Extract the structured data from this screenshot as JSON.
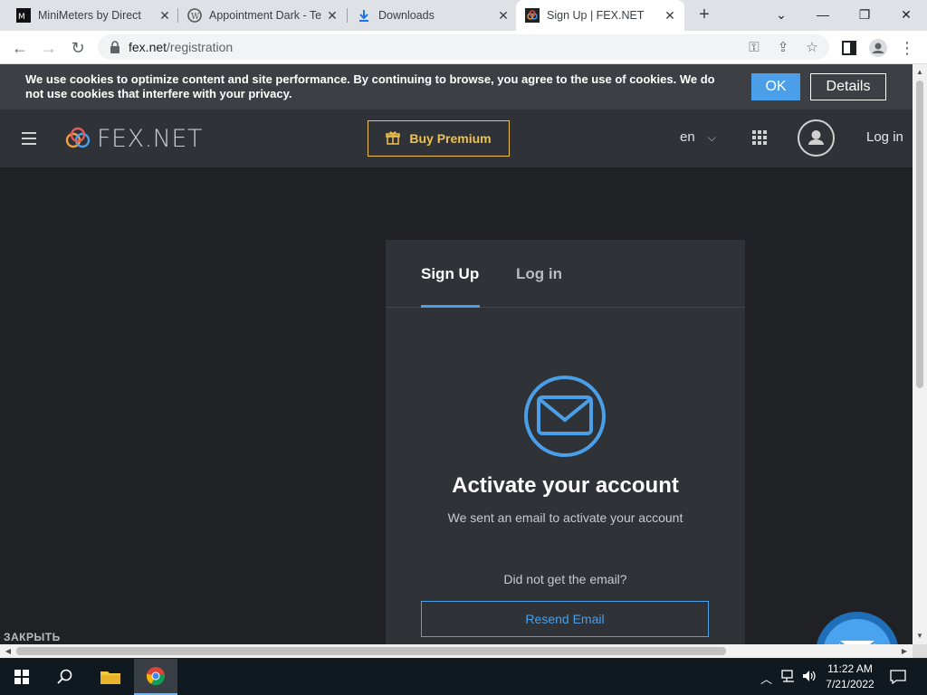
{
  "browser": {
    "tabs": [
      {
        "title": "MiniMeters by Direct",
        "favicon": "minimeters-icon"
      },
      {
        "title": "Appointment Dark - Te",
        "favicon": "wordpress-icon"
      },
      {
        "title": "Downloads",
        "favicon": "download-icon"
      },
      {
        "title": "Sign Up | FEX.NET",
        "favicon": "fex-icon",
        "active": true
      }
    ],
    "new_tab": "+",
    "url_host": "fex.net",
    "url_path": "/registration"
  },
  "cookie_banner": {
    "text": "We use cookies to optimize content and site performance. By continuing to browse, you agree to the use of cookies. We do not use cookies that interfere with your privacy.",
    "ok_label": "OK",
    "details_label": "Details"
  },
  "header": {
    "logo_text": "FEX.NET",
    "premium_label": "Buy Premium",
    "language": "en",
    "login_label": "Log in"
  },
  "auth_card": {
    "tab_signup": "Sign Up",
    "tab_login": "Log in",
    "heading": "Activate your account",
    "subtext": "We sent an email to activate your account",
    "not_received": "Did not get the email?",
    "resend_label": "Resend Email"
  },
  "close_label": "ЗАКРЫТЬ",
  "taskbar": {
    "time": "11:22 AM",
    "date": "7/21/2022"
  },
  "colors": {
    "accent": "#4a9fe8",
    "premium": "#f0c24b",
    "page_bg": "#202124",
    "card_bg": "#2f3237"
  }
}
